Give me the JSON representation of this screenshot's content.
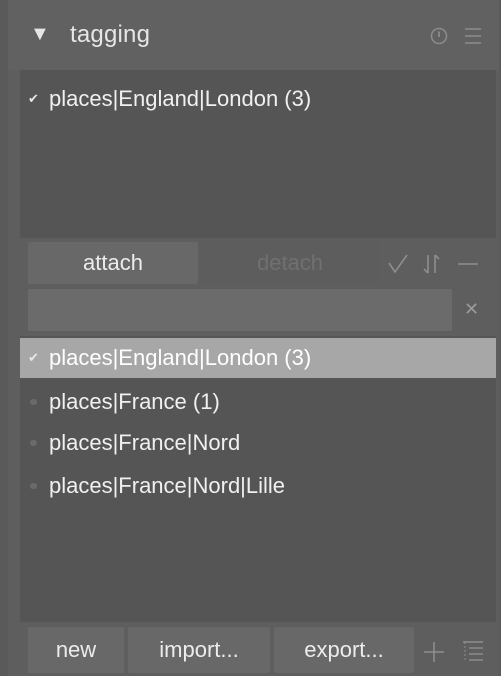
{
  "header": {
    "title": "tagging",
    "collapse_icon": "triangle-down-icon",
    "reset_icon": "reset-icon",
    "presets_icon": "hamburger-menu-icon"
  },
  "attached": {
    "items": [
      {
        "label": "places|England|London (3)",
        "checked": true
      }
    ]
  },
  "actions": {
    "attach_label": "attach",
    "detach_label": "detach",
    "toggle_hide_icon": "checkmark-icon",
    "toggle_sort_icon": "sort-icon",
    "toggle_parents_icon": "minus-icon"
  },
  "entry": {
    "value": "",
    "clear_icon": "close-icon"
  },
  "dictionary": {
    "items": [
      {
        "label": "places|England|London (3)",
        "checked": true,
        "selected": true
      },
      {
        "label": "places|France (1)",
        "checked": false,
        "selected": false
      },
      {
        "label": "places|France|Nord",
        "checked": false,
        "selected": false
      },
      {
        "label": "places|France|Nord|Lille",
        "checked": false,
        "selected": false
      }
    ]
  },
  "footer": {
    "new_label": "new",
    "import_label": "import...",
    "export_label": "export...",
    "add_icon": "plus-icon",
    "tree_icon": "tree-list-icon"
  },
  "colors": {
    "panel_bg": "#5e5e5e",
    "list_bg": "#555555",
    "button_bg": "#686868",
    "selected_row": "#a7a7a7",
    "text": "#f0f0f0",
    "disabled_text": "#707070"
  }
}
